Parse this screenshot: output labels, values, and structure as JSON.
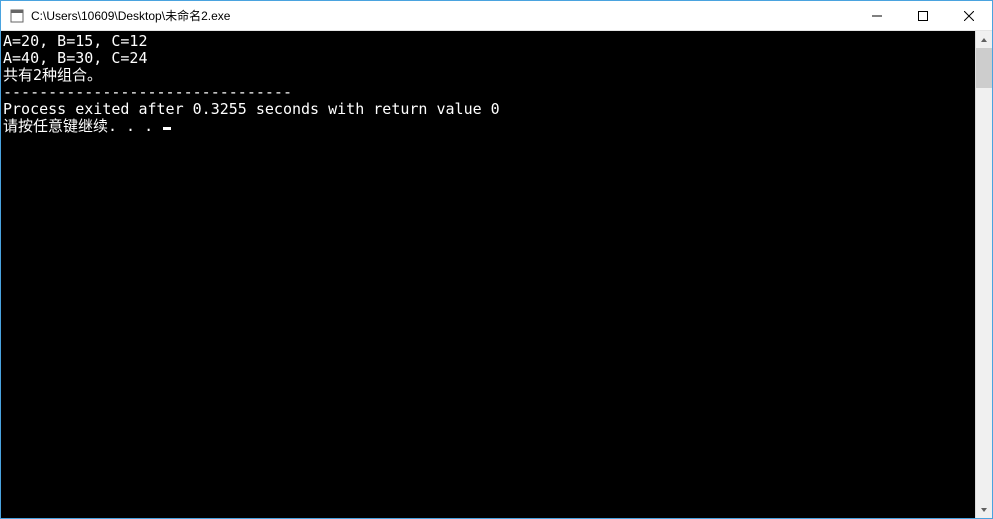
{
  "window": {
    "title": "C:\\Users\\10609\\Desktop\\未命名2.exe"
  },
  "console": {
    "lines": [
      "A=20, B=15, C=12",
      "A=40, B=30, C=24",
      "共有2种组合。",
      "",
      "--------------------------------",
      "Process exited after 0.3255 seconds with return value 0",
      "请按任意键继续. . . "
    ]
  }
}
